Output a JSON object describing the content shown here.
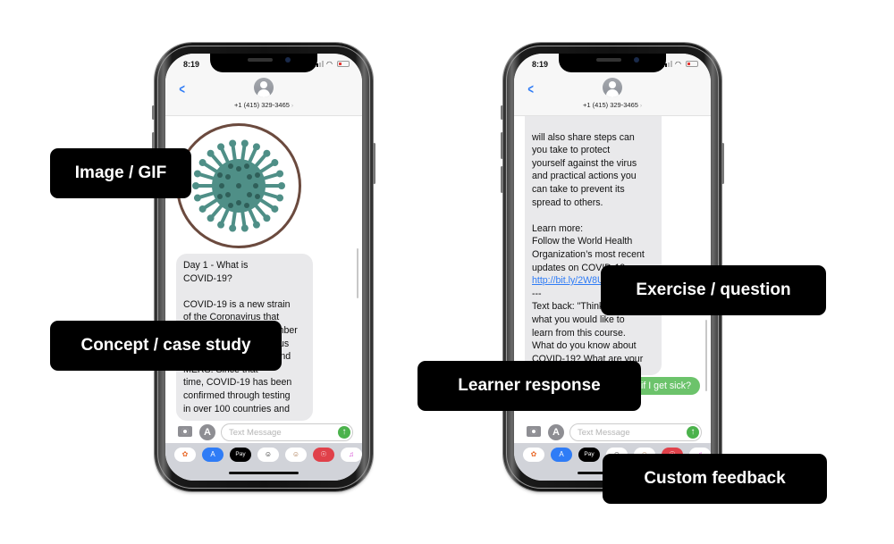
{
  "phones": {
    "left": {
      "status_time": "8:19",
      "contact_number": "+1 (415) 329-3465",
      "image_alt": "coronavirus-illustration",
      "message_text": "Day 1 - What is\nCOVID-19?\n\nCOVID-19 is a new strain\nof the Coronavirus that\nfirst appeared in December\n2019 in Wuhan. Previous\nstrains include SARS and\nMERS. Since that\ntime, COVID-19 has been\nconfirmed through testing\nin over 100 countries and",
      "input_placeholder": "Text Message"
    },
    "right": {
      "status_time": "8:19",
      "contact_number": "+1 (415) 329-3465",
      "message_text_1": "will also share steps can\nyou take to protect\nyourself against the virus\nand practical actions you\ncan take to prevent its\nspread to others.\n\nLearn more:\nFollow the World Health\nOrganization’s most recent\nupdates on COVID-19.",
      "message_link": "http://bit.ly/2W8U-BB",
      "message_text_2": "---\nText back: \"Think about\nwhat you would like to\nlearn from this course.\nWhat do you know about\nCOVID-19?  What are your",
      "reply_text": "What happens if I get sick?",
      "input_placeholder": "Text Message"
    },
    "app_drawer": [
      "photos",
      "app-store",
      "Pay",
      "memoji",
      "animoji",
      "search-images",
      "music"
    ]
  },
  "labels": {
    "image_gif": "Image / GIF",
    "concept": "Concept / case study",
    "exercise": "Exercise / question",
    "learner": "Learner response",
    "feedback": "Custom feedback"
  },
  "colors": {
    "ios_blue": "#2f7cf6",
    "incoming_bubble": "#e9e9eb",
    "outgoing_bubble": "#6cc36b",
    "virus_teal": "#4f8f87",
    "label_bg": "#000000"
  }
}
